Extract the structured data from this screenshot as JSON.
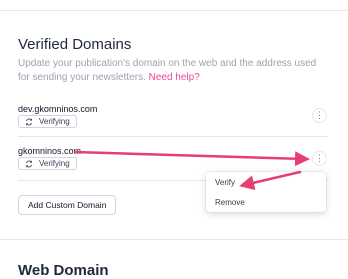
{
  "section": {
    "title": "Verified Domains",
    "description": "Update your publication's domain on the web and the address used for sending your newsletters.",
    "help_link": "Need help?"
  },
  "domains": [
    {
      "name": "dev.gkomninos.com",
      "status": "Verifying",
      "menu_glyph": "⋮"
    },
    {
      "name": "gkomninos.com",
      "status": "Verifying",
      "menu_glyph": "⋮"
    }
  ],
  "add_button": "Add Custom Domain",
  "menu": {
    "items": [
      "Verify",
      "Remove"
    ]
  },
  "next_section": {
    "title": "Web Domain"
  },
  "colors": {
    "accent": "#ec4899",
    "arrow": "#e83f72"
  },
  "icons": {
    "status": "refresh-icon",
    "more": "more-vertical-icon"
  }
}
